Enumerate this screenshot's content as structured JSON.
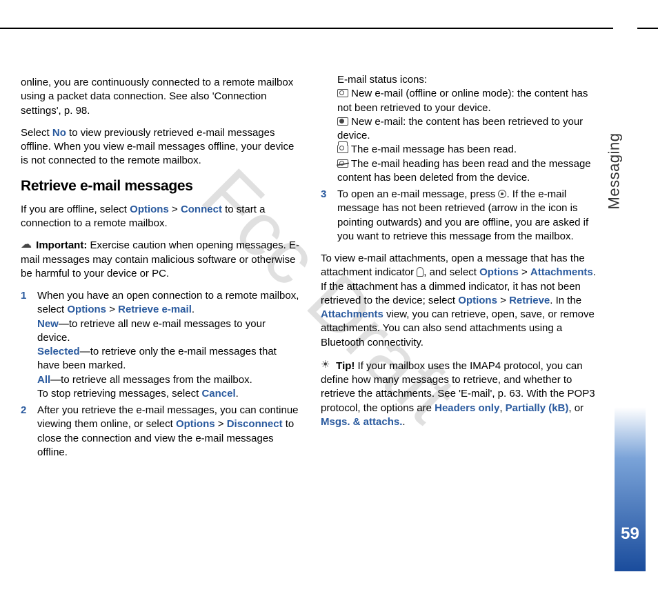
{
  "watermark": "Fcc Draft",
  "side_label": "Messaging",
  "page_number": "59",
  "left": {
    "p1": "online, you are continuously connected to a remote mailbox using a packet data connection. See also 'Connection settings', p. 98.",
    "p2a": "Select ",
    "p2_no": "No",
    "p2b": " to view previously retrieved e-mail messages offline. When you view e-mail messages offline, your device is not connected to the remote mailbox.",
    "h3": "Retrieve e-mail messages",
    "p3a": "If you are offline, select ",
    "p3_opt": "Options",
    "p3_gt": " > ",
    "p3_con": "Connect",
    "p3b": " to start a connection to a remote mailbox.",
    "imp_label": "Important:",
    "imp_text": " Exercise caution when opening messages. E-mail messages may contain malicious software or otherwise be harmful to your device or PC.",
    "li1a": "When you have an open connection to a remote mailbox, select ",
    "li1_opt": "Options",
    "li1_gt": " > ",
    "li1_ret": "Retrieve e-mail",
    "li1_dot": ".",
    "li1_new": "New",
    "li1_new_t": "—to retrieve all new e-mail messages to your device.",
    "li1_sel": "Selected",
    "li1_sel_t": "—to retrieve only the e-mail messages that have been marked.",
    "li1_all": "All",
    "li1_all_t": "—to retrieve all messages from the mailbox.",
    "li1_stop": "To stop retrieving messages, select ",
    "li1_cancel": "Cancel",
    "li2a": "After you retrieve the e-mail messages, you can continue viewing them online, or select ",
    "li2_opt": "Options",
    "li2_gt": " > ",
    "li2_dis": "Disconnect",
    "li2b": " to close the connection and view the e-mail messages offline."
  },
  "right": {
    "li2_cont": "E-mail status icons:",
    "icon1": " New e-mail (offline or online mode): the content has not been retrieved to your device.",
    "icon2": " New e-mail: the content has been retrieved to your device.",
    "icon3": " The e-mail message has been read.",
    "icon4": " The e-mail heading has been read and the message content has been deleted from the device.",
    "li3a": "To open an e-mail message, press ",
    "li3b": ". If the e-mail message has not been retrieved (arrow in the icon is pointing outwards) and you are offline, you are asked if you want to retrieve this message from the mailbox.",
    "p4a": "To view e-mail attachments, open a message that has the attachment indicator ",
    "p4b": ", and select ",
    "p4_opt": "Options",
    "p4_gt": " > ",
    "p4_att": "Attachments",
    "p4c": ". If the attachment has a dimmed indicator, it has not been retrieved to the device; select ",
    "p4_opt2": "Options",
    "p4_gt2": " > ",
    "p4_ret": "Retrieve",
    "p4d": ". In the ",
    "p4_attv": "Attachments",
    "p4e": " view, you can retrieve, open, save, or remove attachments. You can also send attachments using a Bluetooth connectivity.",
    "tip_label": "Tip!",
    "tip_a": " If your mailbox uses the IMAP4 protocol, you can define how many messages to retrieve, and whether to retrieve the attachments. See 'E-mail', p. 63. With the POP3 protocol, the options are ",
    "tip_h": "Headers only",
    "tip_c1": ", ",
    "tip_p": "Partially (kB)",
    "tip_c2": ", or ",
    "tip_m": "Msgs. & attachs.",
    "tip_end": "."
  }
}
